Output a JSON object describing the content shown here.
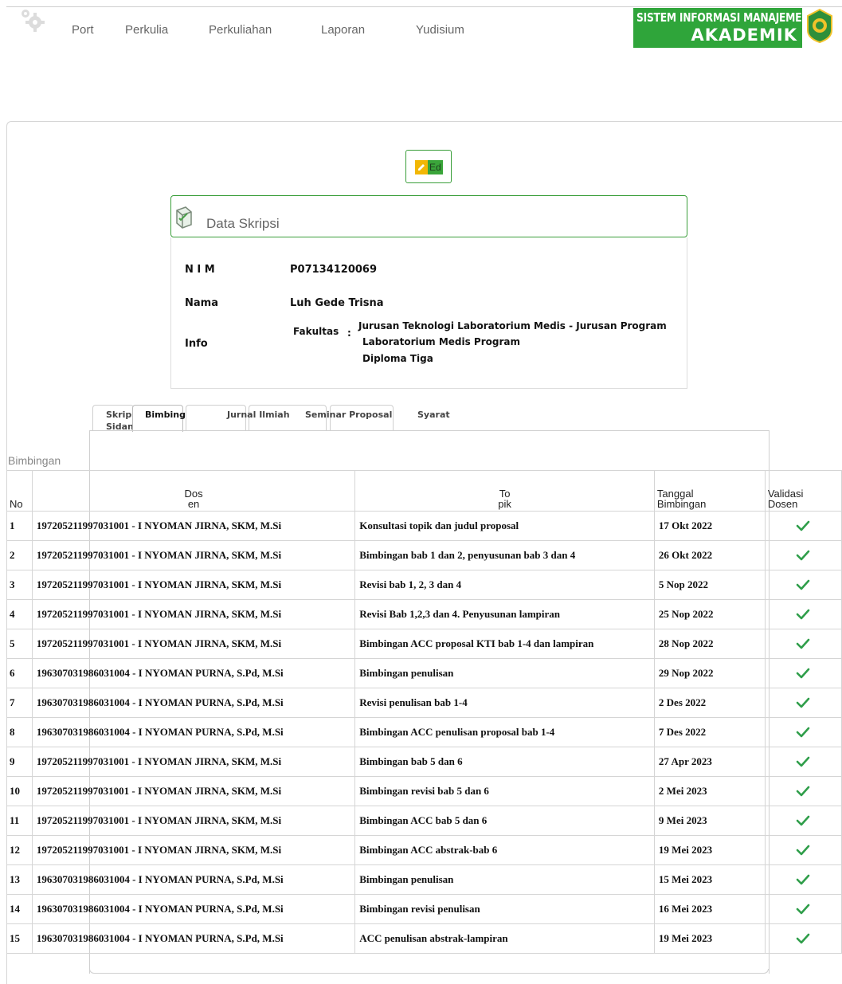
{
  "nav": {
    "items": [
      "Port",
      "Perkulia",
      "Perkuliahan",
      "Laporan",
      "Yudisium"
    ]
  },
  "brand": {
    "line1": "SISTEM INFORMASI MANAJEMEN",
    "line2": "AKADEMIK",
    "color": "#2fa53a"
  },
  "edit_button": {
    "label": "Ed",
    "icon": "pencil-icon"
  },
  "panel": {
    "title": "Data Skripsi",
    "icon": "books-icon",
    "nim_label": "N I M",
    "nim_value": "P07134120069",
    "nama_label": "Nama",
    "nama_value": "Luh Gede Trisna",
    "info_label": "Info",
    "info_key": "Fakultas",
    "info_sep": ":",
    "info_line1": "Jurusan Teknologi Laboratorium Medis - Jurusan Program",
    "info_line2": "Laboratorium Medis Program",
    "info_line3": "Diploma Tiga"
  },
  "tabs": {
    "skripsi": "Skrips",
    "sidang": "Sidang",
    "bimbingan": "Bimbingan",
    "jurnal": "Jurnal Ilmiah",
    "seminar": "Seminar Proposal",
    "syarat": "Syarat"
  },
  "section_caption": "Bimbingan",
  "table": {
    "headers": {
      "no": "No",
      "dosen_1": "Dos",
      "dosen_2": "en",
      "topik_1": "To",
      "topik_2": "pik",
      "tanggal_1": "Tanggal",
      "tanggal_2": "Bimbingan",
      "validasi_1": "Validasi",
      "validasi_2": "Dosen"
    },
    "rows": [
      {
        "no": "1",
        "dosen": "197205211997031001 - I NYOMAN JIRNA, SKM, M.Si",
        "topik": "Konsultasi topik dan judul proposal",
        "tanggal": "17 Okt 2022"
      },
      {
        "no": "2",
        "dosen": "197205211997031001 - I NYOMAN JIRNA, SKM, M.Si",
        "topik": "Bimbingan bab 1 dan 2, penyusunan bab 3 dan 4",
        "tanggal": "26 Okt 2022"
      },
      {
        "no": "3",
        "dosen": "197205211997031001 - I NYOMAN JIRNA, SKM, M.Si",
        "topik": "Revisi bab 1, 2, 3 dan 4",
        "tanggal": "5 Nop 2022"
      },
      {
        "no": "4",
        "dosen": "197205211997031001 - I NYOMAN JIRNA, SKM, M.Si",
        "topik": "Revisi Bab 1,2,3 dan 4. Penyusunan lampiran",
        "tanggal": "25 Nop 2022"
      },
      {
        "no": "5",
        "dosen": "197205211997031001 - I NYOMAN JIRNA, SKM, M.Si",
        "topik": "Bimbingan ACC proposal KTI bab 1-4 dan lampiran",
        "tanggal": "28 Nop 2022"
      },
      {
        "no": "6",
        "dosen": "196307031986031004 - I NYOMAN PURNA, S.Pd, M.Si",
        "topik": "Bimbingan penulisan",
        "tanggal": "29 Nop 2022"
      },
      {
        "no": "7",
        "dosen": "196307031986031004 - I NYOMAN PURNA, S.Pd, M.Si",
        "topik": "Revisi penulisan bab 1-4",
        "tanggal": "2 Des 2022"
      },
      {
        "no": "8",
        "dosen": "196307031986031004 - I NYOMAN PURNA, S.Pd, M.Si",
        "topik": "Bimbingan ACC penulisan proposal bab 1-4",
        "tanggal": "7 Des 2022"
      },
      {
        "no": "9",
        "dosen": "197205211997031001 - I NYOMAN JIRNA, SKM, M.Si",
        "topik": "Bimbingan bab 5 dan 6",
        "tanggal": "27 Apr 2023"
      },
      {
        "no": "10",
        "dosen": "197205211997031001 - I NYOMAN JIRNA, SKM, M.Si",
        "topik": "Bimbingan revisi bab 5 dan 6",
        "tanggal": "2 Mei 2023"
      },
      {
        "no": "11",
        "dosen": "197205211997031001 - I NYOMAN JIRNA, SKM, M.Si",
        "topik": "Bimbingan ACC bab 5 dan 6",
        "tanggal": "9 Mei 2023"
      },
      {
        "no": "12",
        "dosen": "197205211997031001 - I NYOMAN JIRNA, SKM, M.Si",
        "topik": "Bimbingan ACC abstrak-bab 6",
        "tanggal": "19 Mei 2023"
      },
      {
        "no": "13",
        "dosen": "196307031986031004 - I NYOMAN PURNA, S.Pd, M.Si",
        "topik": "Bimbingan penulisan",
        "tanggal": "15 Mei 2023"
      },
      {
        "no": "14",
        "dosen": "196307031986031004 - I NYOMAN PURNA, S.Pd, M.Si",
        "topik": "Bimbingan revisi penulisan",
        "tanggal": "16 Mei 2023"
      },
      {
        "no": "15",
        "dosen": "196307031986031004 - I NYOMAN PURNA, S.Pd, M.Si",
        "topik": "ACC penulisan abstrak-lampiran",
        "tanggal": "19 Mei 2023"
      }
    ],
    "validated_icon": "check-icon",
    "check_color": "#2f9e4a"
  }
}
